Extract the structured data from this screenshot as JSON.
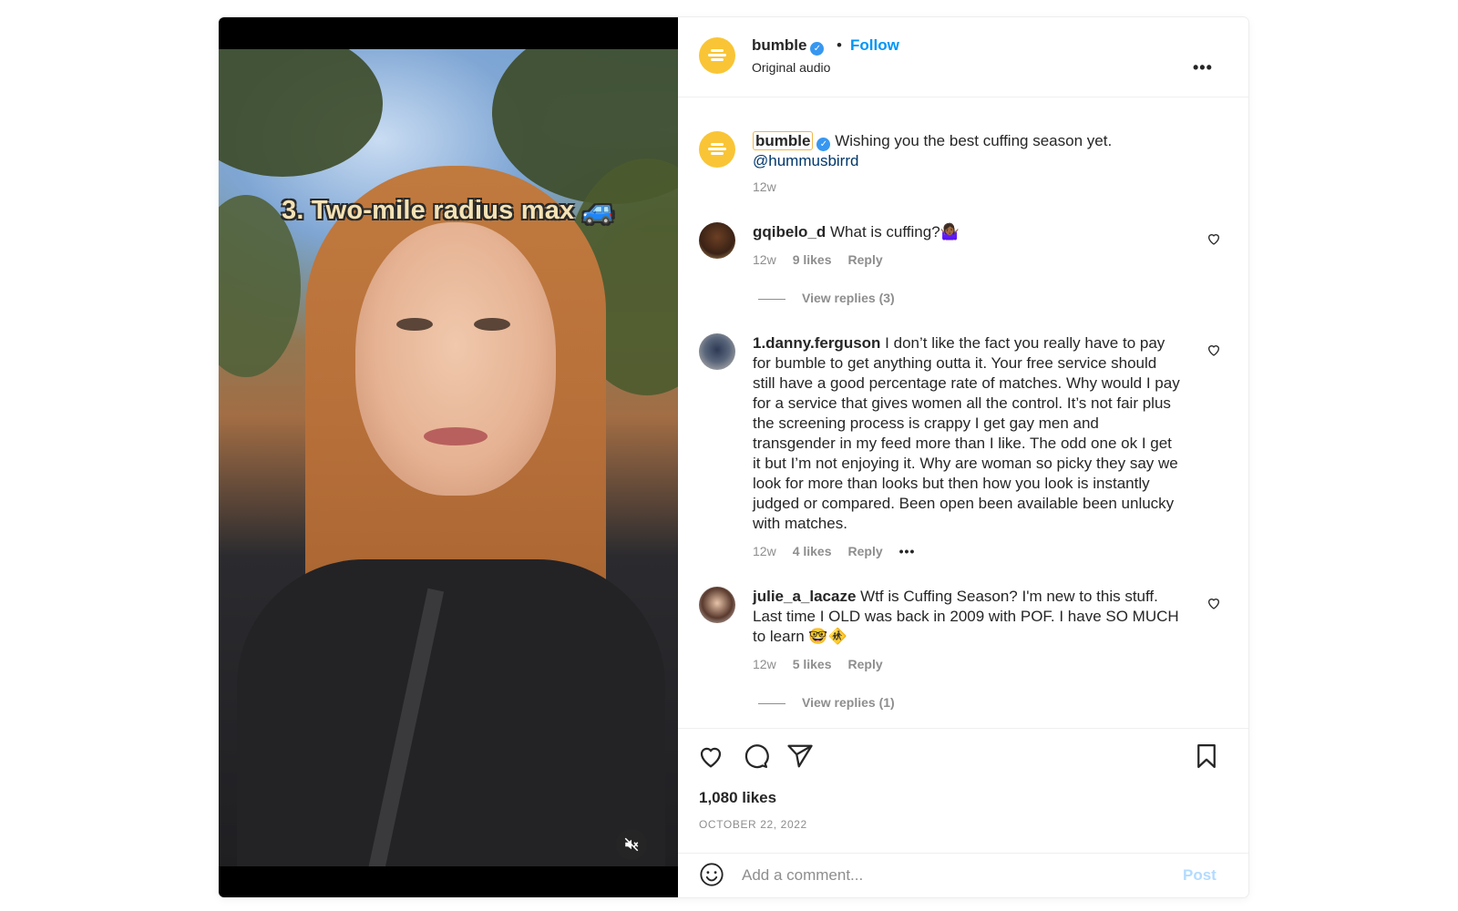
{
  "video": {
    "overlay_text": "3. Two-mile radius max 🚙",
    "mute_icon": "speaker-muted-icon"
  },
  "header": {
    "username": "bumble",
    "verified": "✓",
    "separator": "•",
    "follow_label": "Follow",
    "audio_label": "Original audio",
    "more_label": "•••"
  },
  "caption": {
    "username": "bumble",
    "text": "Wishing you the best cuffing season yet.",
    "mention": "@hummusbirrd",
    "time": "12w"
  },
  "comments": [
    {
      "username": "gqibelo_d",
      "text": "What is cuffing?🤷🏾‍♀️",
      "time": "12w",
      "likes": "9 likes",
      "reply_label": "Reply",
      "view_replies": "View replies (3)"
    },
    {
      "username": "1.danny.ferguson",
      "text": "I don’t like the fact you really have to pay for bumble to get anything outta it. Your free service should still have a good percentage rate of matches. Why would I pay for a service that gives women all the control. It’s not fair plus the screening process is crappy I get gay men and transgender in my feed more than I like. The odd one ok I get it but I’m not enjoying it. Why are woman so picky they say we look for more than looks but then how you look is instantly judged or compared. Been open been available been unlucky with matches.",
      "time": "12w",
      "likes": "4 likes",
      "reply_label": "Reply",
      "more_label": "•••"
    },
    {
      "username": "julie_a_lacaze",
      "text": "Wtf is Cuffing Season? I'm new to this stuff. Last time I OLD was back in 2009 with POF. I have SO MUCH to learn 🤓🚸",
      "time": "12w",
      "likes": "5 likes",
      "reply_label": "Reply",
      "view_replies": "View replies (1)"
    }
  ],
  "actions": {
    "like_icon": "heart-icon",
    "comment_icon": "comment-bubble-icon",
    "share_icon": "send-icon",
    "save_icon": "bookmark-icon",
    "likes_count": "1,080 likes",
    "date": "OCTOBER 22, 2022"
  },
  "add_comment": {
    "placeholder": "Add a comment...",
    "post_label": "Post"
  },
  "colors": {
    "bumble_yellow": "#f9c536",
    "follow_blue": "#0095f6",
    "post_disabled": "#b3dbff",
    "verified_blue": "#3797f0"
  }
}
